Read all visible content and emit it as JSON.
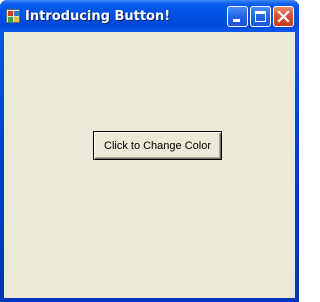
{
  "window": {
    "title": "Introducing Button!",
    "app_icon": "windows-form-icon",
    "caption_buttons": {
      "minimize_icon": "minimize-icon",
      "maximize_icon": "maximize-icon",
      "close_icon": "close-icon"
    },
    "colors": {
      "titlebar": "#0052e6",
      "client_background": "#ece9d8",
      "close_button": "#d6502d"
    }
  },
  "form": {
    "button_label": "Click to Change Color"
  }
}
